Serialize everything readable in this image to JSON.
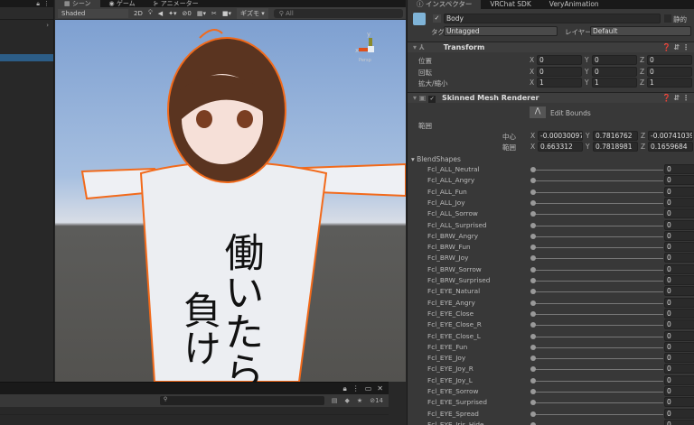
{
  "hierarchy": {
    "lock_icon": "lock-icon",
    "menu_icon": "more-icon",
    "arrow": "›"
  },
  "scene": {
    "tabs": [
      {
        "label": "シーン",
        "icon": "scene-icon"
      },
      {
        "label": "ゲーム",
        "icon": "game-icon"
      },
      {
        "label": "アニメーター",
        "icon": "animator-icon"
      }
    ],
    "shading": "Shaded",
    "mode_2d": "2D",
    "hidden_count": "0",
    "gizmos": "ギズモ",
    "search_placeholder": "All",
    "gizmo": {
      "y": "y",
      "x": "x",
      "persp": "Persp"
    },
    "shirt_text_1": "働いたら",
    "shirt_text_2": "負け"
  },
  "inspector": {
    "tabs": [
      "インスペクター",
      "VRChat SDK",
      "VeryAnimation"
    ],
    "object_name": "Body",
    "static_label": "静的",
    "tag_label": "タグ",
    "tag_value": "Untagged",
    "layer_label": "レイヤー",
    "layer_value": "Default",
    "transform": {
      "title": "Transform",
      "rows": [
        {
          "label": "位置",
          "x": "0",
          "y": "0",
          "z": "0"
        },
        {
          "label": "回転",
          "x": "0",
          "y": "0",
          "z": "0"
        },
        {
          "label": "拡大/縮小",
          "x": "1",
          "y": "1",
          "z": "1"
        }
      ]
    },
    "smr": {
      "title": "Skinned Mesh Renderer",
      "edit_bounds": "Edit Bounds",
      "bounds_label": "範囲",
      "center": {
        "label": "中心",
        "x": "-0.00030097",
        "y": "0.7816762",
        "z": "-0.00741039"
      },
      "extent": {
        "label": "範囲",
        "x": "0.663312",
        "y": "0.7818981",
        "z": "0.1659684"
      }
    },
    "blendshapes_label": "BlendShapes",
    "blendshapes": [
      {
        "name": "Fcl_ALL_Neutral",
        "value": "0"
      },
      {
        "name": "Fcl_ALL_Angry",
        "value": "0"
      },
      {
        "name": "Fcl_ALL_Fun",
        "value": "0"
      },
      {
        "name": "Fcl_ALL_Joy",
        "value": "0"
      },
      {
        "name": "Fcl_ALL_Sorrow",
        "value": "0"
      },
      {
        "name": "Fcl_ALL_Surprised",
        "value": "0"
      },
      {
        "name": "Fcl_BRW_Angry",
        "value": "0"
      },
      {
        "name": "Fcl_BRW_Fun",
        "value": "0"
      },
      {
        "name": "Fcl_BRW_Joy",
        "value": "0"
      },
      {
        "name": "Fcl_BRW_Sorrow",
        "value": "0"
      },
      {
        "name": "Fcl_BRW_Surprised",
        "value": "0"
      },
      {
        "name": "Fcl_EYE_Natural",
        "value": "0"
      },
      {
        "name": "Fcl_EYE_Angry",
        "value": "0"
      },
      {
        "name": "Fcl_EYE_Close",
        "value": "0"
      },
      {
        "name": "Fcl_EYE_Close_R",
        "value": "0"
      },
      {
        "name": "Fcl_EYE_Close_L",
        "value": "0"
      },
      {
        "name": "Fcl_EYE_Fun",
        "value": "0"
      },
      {
        "name": "Fcl_EYE_Joy",
        "value": "0"
      },
      {
        "name": "Fcl_EYE_Joy_R",
        "value": "0"
      },
      {
        "name": "Fcl_EYE_Joy_L",
        "value": "0"
      },
      {
        "name": "Fcl_EYE_Sorrow",
        "value": "0"
      },
      {
        "name": "Fcl_EYE_Surprised",
        "value": "0"
      },
      {
        "name": "Fcl_EYE_Spread",
        "value": "0"
      },
      {
        "name": "Fcl_EYE_Iris_Hide",
        "value": "0"
      }
    ]
  },
  "project": {
    "hidden_count": "14"
  },
  "colors": {
    "selection": "#2c5d87",
    "outline": "#f26a1b",
    "panel": "#383838"
  }
}
